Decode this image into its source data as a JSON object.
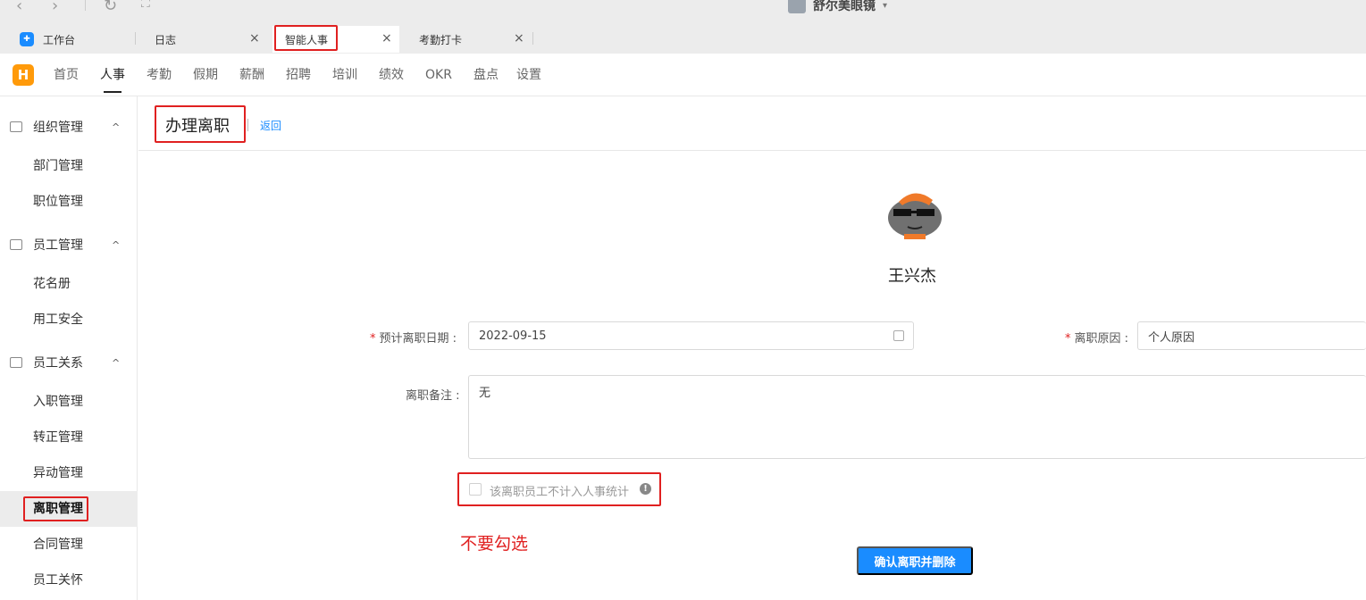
{
  "browser": {
    "back": "‹",
    "forward": "›",
    "reload": "↻",
    "expand": "⛶",
    "org_name": "舒尔美眼镜",
    "org_caret": "▾"
  },
  "tabs": [
    {
      "label": "工作台",
      "icon": "app-grid-icon"
    },
    {
      "label": "日志",
      "close": "×"
    },
    {
      "label": "智能人事",
      "close": "×"
    },
    {
      "label": "考勤打卡",
      "close": "×"
    }
  ],
  "app": {
    "logo": "H",
    "menu": [
      "首页",
      "人事",
      "考勤",
      "假期",
      "薪酬",
      "招聘",
      "培训",
      "绩效",
      "OKR",
      "盘点",
      "设置"
    ],
    "active_menu": "人事"
  },
  "sidebar": {
    "groups": [
      {
        "label": "组织管理",
        "icon": "org-chart-icon",
        "items": [
          "部门管理",
          "职位管理"
        ]
      },
      {
        "label": "员工管理",
        "icon": "folder-user-icon",
        "items": [
          "花名册",
          "用工安全"
        ]
      },
      {
        "label": "员工关系",
        "icon": "relation-icon",
        "items": [
          "入职管理",
          "转正管理",
          "异动管理",
          "离职管理",
          "合同管理",
          "员工关怀"
        ]
      }
    ],
    "caret": "^",
    "active_item": "离职管理"
  },
  "page": {
    "title": "办理离职",
    "back_link": "返回",
    "employee_name": "王兴杰",
    "form": {
      "required_mark": "*",
      "date_label": "预计离职日期 :",
      "date_value": "2022-09-15",
      "reason_label": "离职原因 :",
      "reason_value": "个人原因",
      "remark_label": "离职备注 :",
      "remark_value": "无",
      "checkbox_label": "该离职员工不计入人事统计",
      "info_mark": "!"
    },
    "annotation": "不要勾选",
    "submit_button": "确认离职并删除"
  },
  "colors": {
    "accent": "#1a8cff",
    "highlight": "#e02020",
    "logo": "#ff9a0a"
  }
}
